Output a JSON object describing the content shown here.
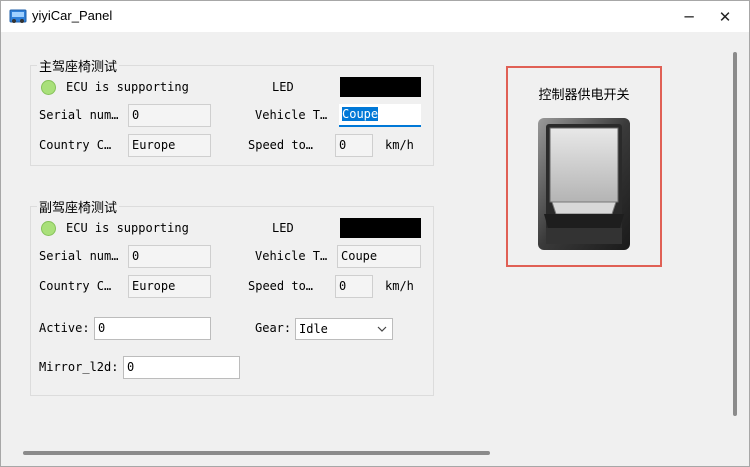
{
  "window": {
    "title": "yiyiCar_Panel",
    "minimize_glyph": "─",
    "close_glyph": "✕"
  },
  "driver_seat": {
    "group_title": "主驾座椅测试",
    "ecu_status": "ECU is supporting",
    "led_label": "LED",
    "serial_label": "Serial num…",
    "serial_value": "0",
    "vehicle_type_label": "Vehicle T…",
    "vehicle_type_value": "Coupe",
    "country_label": "Country C…",
    "country_value": "Europe",
    "speed_label": "Speed to…",
    "speed_value": "0",
    "speed_unit": "km/h"
  },
  "passenger_seat": {
    "group_title": "副驾座椅测试",
    "ecu_status": "ECU is supporting",
    "led_label": "LED",
    "serial_label": "Serial num…",
    "serial_value": "0",
    "vehicle_type_label": "Vehicle T…",
    "vehicle_type_value": "Coupe",
    "country_label": "Country C…",
    "country_value": "Europe",
    "speed_label": "Speed to…",
    "speed_value": "0",
    "speed_unit": "km/h",
    "active_label": "Active:",
    "active_value": "0",
    "gear_label": "Gear:",
    "gear_value": "Idle",
    "mirror_label": "Mirror_l2d:",
    "mirror_value": "0"
  },
  "power_switch": {
    "title": "控制器供电开关",
    "state": "off"
  },
  "colors": {
    "led_off": "#000000",
    "ecu_ok": "#a9e07a",
    "focus_accent": "#0078d7",
    "switch_highlight": "#e06055"
  }
}
